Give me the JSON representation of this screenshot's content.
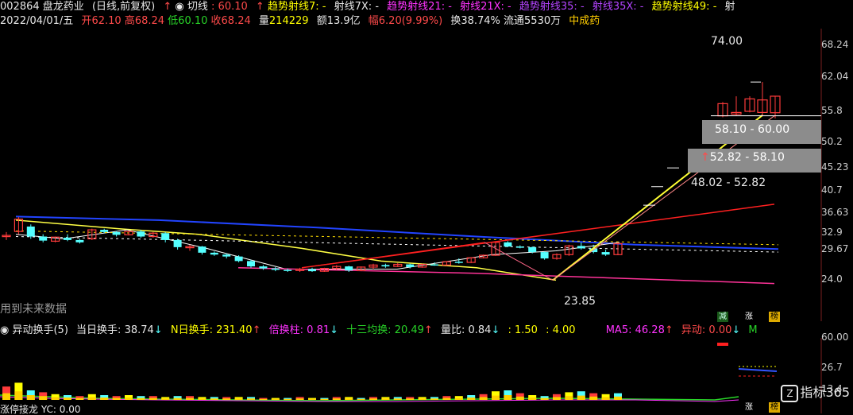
{
  "header": {
    "code": "002864",
    "name": "盘龙药业",
    "period": "(日线,前复权)",
    "qiexian_label": "切线",
    "qiexian_value": ": 60.10",
    "qushi7_label": "趋势射线7:",
    "qushi7_value": "-",
    "shexian7x_label": "射线7X:",
    "shexian7x_value": "-",
    "qushi21_label": "趋势射线21:",
    "qushi21_value": "-",
    "shexian21x_label": "射线21X:",
    "shexian21x_value": "-",
    "qushi35_label": "趋势射线35:",
    "qushi35_value": "-",
    "shexian35x_label": "射线35X:",
    "shexian35x_value": "-",
    "qushi49_label": "趋势射线49:",
    "qushi49_value": "-",
    "shexian_trunc": "射",
    "date": "2022/04/01/五",
    "open": "开62.10",
    "high": "高68.24",
    "low": "低60.10",
    "close": "收68.24",
    "volume_label": "量",
    "volume_value": "214229",
    "amount": "额13.9亿",
    "range": "幅6.20(9.99%)",
    "turnover": "换38.74%",
    "float": "流通5530万",
    "sector": "中成药"
  },
  "annotations": {
    "high_mark": "74.00",
    "low_mark": "23.85",
    "zone1": "58.10 - 60.00",
    "zone2": "52.82 - 58.10",
    "zone3": "48.02 - 52.82",
    "future_note": "用到未来数据"
  },
  "axis_main": [
    "68.24",
    "62.04",
    "55.8",
    "50.2",
    "45.23",
    "40.7",
    "36.63",
    "32.9",
    "29.67",
    "24.0"
  ],
  "indicator": {
    "name": "异动换手(5)",
    "dangri_label": "当日换手:",
    "dangri_value": "38.74",
    "nri_label": "N日换手:",
    "nri_value": "231.40",
    "beihuan_label": "倍换柱:",
    "beihuan_value": "0.81",
    "shisan_label": "十三均换:",
    "shisan_value": "20.49",
    "liangbi_label": "量比:",
    "liangbi_value": "0.84",
    "v1": ": 1.50",
    "v2": ": 4.00",
    "ma5_label": "MA5:",
    "ma5_value": "46.28",
    "yidong_label": "异动:",
    "yidong_value": "0.00",
    "trunc": "M"
  },
  "axis_sub": [
    "60.00",
    "26.7",
    "13.4"
  ],
  "sub2": {
    "label": "涨停接龙",
    "yc": "YC: 0.00"
  },
  "badges": {
    "jian": "减",
    "zhang": "涨",
    "bang": "榜",
    "zhang2": "涨",
    "bang2": "榜"
  },
  "logo": "指标365",
  "colors": {
    "up": "#ff3b3b",
    "down": "#55ffff",
    "bg": "#000000"
  },
  "chart_data": {
    "type": "candlestick",
    "note_units": "price",
    "candles": [
      [
        30.6,
        31.4,
        30.0,
        30.8
      ],
      [
        31.5,
        34.2,
        31.0,
        33.8
      ],
      [
        32.4,
        32.8,
        30.2,
        30.6
      ],
      [
        30.6,
        31.0,
        29.6,
        29.9
      ],
      [
        29.8,
        30.6,
        29.6,
        30.5
      ],
      [
        30.4,
        31.0,
        29.8,
        30.0
      ],
      [
        30.0,
        30.2,
        29.4,
        29.6
      ],
      [
        30.2,
        32.0,
        30.0,
        31.8
      ],
      [
        31.8,
        32.0,
        31.2,
        31.4
      ],
      [
        31.4,
        31.6,
        30.6,
        30.9
      ],
      [
        30.9,
        31.6,
        30.8,
        31.5
      ],
      [
        31.5,
        31.8,
        30.4,
        30.6
      ],
      [
        30.6,
        31.4,
        30.4,
        31.2
      ],
      [
        31.2,
        31.4,
        29.6,
        30.0
      ],
      [
        30.0,
        30.2,
        28.4,
        28.8
      ],
      [
        28.8,
        29.2,
        28.2,
        28.9
      ],
      [
        28.9,
        29.0,
        27.6,
        27.9
      ],
      [
        27.9,
        28.1,
        27.4,
        27.6
      ],
      [
        27.6,
        27.8,
        27.0,
        27.3
      ],
      [
        27.3,
        27.5,
        26.4,
        26.6
      ],
      [
        26.6,
        26.8,
        25.6,
        25.8
      ],
      [
        25.8,
        26.0,
        25.3,
        25.5
      ],
      [
        25.5,
        25.7,
        25.1,
        25.3
      ],
      [
        25.3,
        25.5,
        25.0,
        25.2
      ],
      [
        25.2,
        25.6,
        25.0,
        25.4
      ],
      [
        25.4,
        25.6,
        25.0,
        25.1
      ],
      [
        25.1,
        25.6,
        25.0,
        25.5
      ],
      [
        25.5,
        26.0,
        25.3,
        25.8
      ],
      [
        25.8,
        25.9,
        25.0,
        25.2
      ],
      [
        25.2,
        25.8,
        25.1,
        25.7
      ],
      [
        25.7,
        26.2,
        25.4,
        26.0
      ],
      [
        26.0,
        26.2,
        25.6,
        25.8
      ],
      [
        25.8,
        26.3,
        25.7,
        26.1
      ],
      [
        26.1,
        26.2,
        25.5,
        25.7
      ],
      [
        25.7,
        26.2,
        25.6,
        26.1
      ],
      [
        26.1,
        26.4,
        25.9,
        26.0
      ],
      [
        26.0,
        26.6,
        25.9,
        26.5
      ],
      [
        26.5,
        27.0,
        26.2,
        26.4
      ],
      [
        26.4,
        27.2,
        26.3,
        27.1
      ],
      [
        27.1,
        27.6,
        27.0,
        27.5
      ],
      [
        27.5,
        29.8,
        27.4,
        29.6
      ],
      [
        29.6,
        29.8,
        28.8,
        28.9
      ],
      [
        28.9,
        29.1,
        28.6,
        28.8
      ],
      [
        28.8,
        28.9,
        27.8,
        28.0
      ],
      [
        28.0,
        28.1,
        26.8,
        27.0
      ],
      [
        27.0,
        27.8,
        26.8,
        27.6
      ],
      [
        27.6,
        29.2,
        27.4,
        29.0
      ],
      [
        29.0,
        29.6,
        28.4,
        28.6
      ],
      [
        28.6,
        29.2,
        27.8,
        28.0
      ],
      [
        28.0,
        28.4,
        27.4,
        27.6
      ],
      [
        27.6,
        29.6,
        27.5,
        29.4
      ],
      [
        61.0,
        66.0,
        60.5,
        65.4
      ],
      [
        61.6,
        68.2,
        61.2,
        62.2
      ],
      [
        62.6,
        68.2,
        62.2,
        67.2
      ],
      [
        62.2,
        74.0,
        61.2,
        66.8
      ],
      [
        62.1,
        68.24,
        60.1,
        68.24
      ]
    ]
  }
}
